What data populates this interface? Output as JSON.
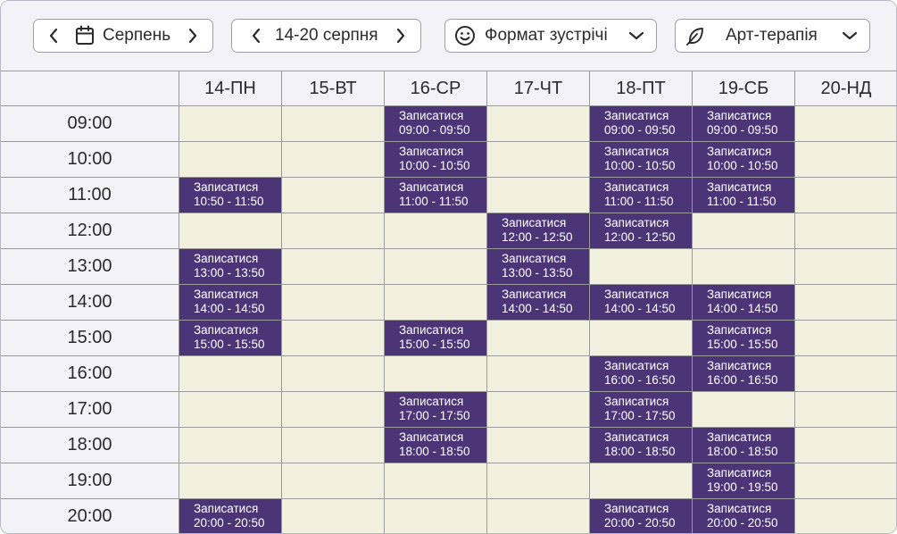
{
  "toolbar": {
    "month": {
      "label": "Серпень",
      "icon": "calendar-icon"
    },
    "week": {
      "label": "14-20 серпня"
    },
    "format": {
      "label": "Формат зустрічі",
      "icon": "smile-icon"
    },
    "therapy": {
      "label": "Арт-терапія",
      "icon": "feather-icon"
    }
  },
  "colors": {
    "slot": "#4b3576",
    "cell": "#f2f0df",
    "header": "#f3f3f7"
  },
  "days": [
    "14-ПН",
    "15-ВТ",
    "16-СР",
    "17-ЧТ",
    "18-ПТ",
    "19-СБ",
    "20-НД"
  ],
  "times": [
    "09:00",
    "10:00",
    "11:00",
    "12:00",
    "13:00",
    "14:00",
    "15:00",
    "16:00",
    "17:00",
    "18:00",
    "19:00",
    "20:00"
  ],
  "slot_label": "Записатися",
  "slots": [
    {
      "day": 2,
      "row": 0,
      "time": "09:00 - 09:50"
    },
    {
      "day": 4,
      "row": 0,
      "time": "09:00 - 09:50"
    },
    {
      "day": 5,
      "row": 0,
      "time": "09:00 - 09:50"
    },
    {
      "day": 2,
      "row": 1,
      "time": "10:00 - 10:50"
    },
    {
      "day": 4,
      "row": 1,
      "time": "10:00 - 10:50"
    },
    {
      "day": 5,
      "row": 1,
      "time": "10:00 - 10:50"
    },
    {
      "day": 0,
      "row": 2,
      "time": "10:50 - 11:50"
    },
    {
      "day": 2,
      "row": 2,
      "time": "11:00 - 11:50"
    },
    {
      "day": 4,
      "row": 2,
      "time": "11:00 - 11:50"
    },
    {
      "day": 5,
      "row": 2,
      "time": "11:00 - 11:50"
    },
    {
      "day": 3,
      "row": 3,
      "time": "12:00 - 12:50"
    },
    {
      "day": 4,
      "row": 3,
      "time": "12:00 - 12:50"
    },
    {
      "day": 0,
      "row": 4,
      "time": "13:00 - 13:50"
    },
    {
      "day": 3,
      "row": 4,
      "time": "13:00 - 13:50"
    },
    {
      "day": 0,
      "row": 5,
      "time": "14:00 - 14:50"
    },
    {
      "day": 3,
      "row": 5,
      "time": "14:00 - 14:50"
    },
    {
      "day": 4,
      "row": 5,
      "time": "14:00 - 14:50"
    },
    {
      "day": 5,
      "row": 5,
      "time": "14:00 - 14:50"
    },
    {
      "day": 0,
      "row": 6,
      "time": "15:00 - 15:50"
    },
    {
      "day": 2,
      "row": 6,
      "time": "15:00 - 15:50"
    },
    {
      "day": 5,
      "row": 6,
      "time": "15:00 - 15:50"
    },
    {
      "day": 4,
      "row": 7,
      "time": "16:00 - 16:50"
    },
    {
      "day": 5,
      "row": 7,
      "time": "16:00 - 16:50"
    },
    {
      "day": 2,
      "row": 8,
      "time": "17:00 - 17:50"
    },
    {
      "day": 4,
      "row": 8,
      "time": "17:00 - 17:50"
    },
    {
      "day": 2,
      "row": 9,
      "time": "18:00 - 18:50"
    },
    {
      "day": 4,
      "row": 9,
      "time": "18:00 - 18:50"
    },
    {
      "day": 5,
      "row": 9,
      "time": "18:00 - 18:50"
    },
    {
      "day": 5,
      "row": 10,
      "time": "19:00 - 19:50"
    },
    {
      "day": 0,
      "row": 11,
      "time": "20:00 - 20:50"
    },
    {
      "day": 4,
      "row": 11,
      "time": "20:00 - 20:50"
    },
    {
      "day": 5,
      "row": 11,
      "time": "20:00 - 20:50"
    }
  ]
}
